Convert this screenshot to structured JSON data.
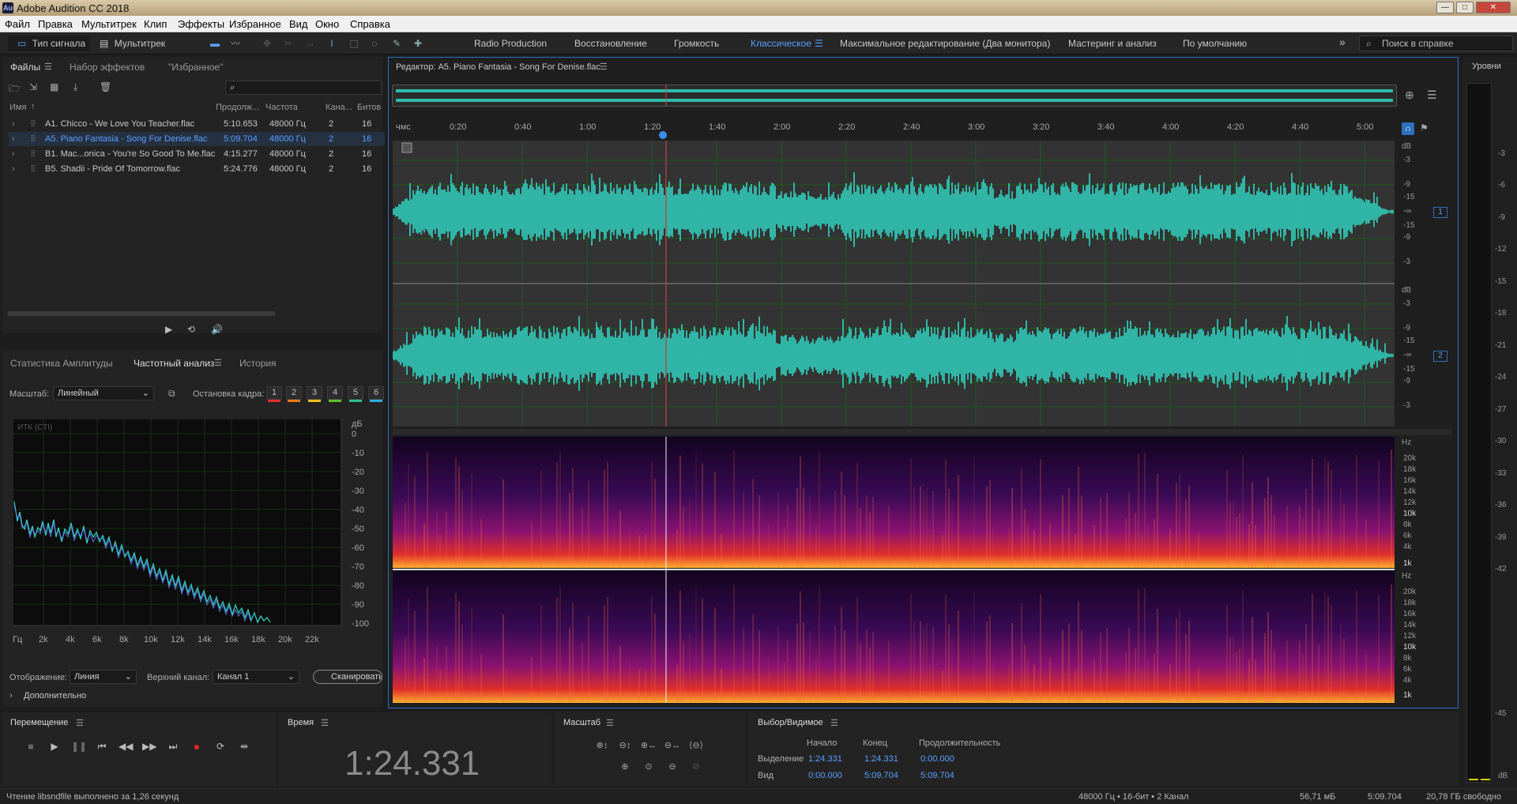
{
  "app": {
    "title": "Adobe Audition CC 2018",
    "logo": "Au",
    "window_controls": [
      "—",
      "□",
      "✕"
    ]
  },
  "menu": [
    "Файл",
    "Правка",
    "Мультитрек",
    "Клип",
    "Эффекты",
    "Избранное",
    "Вид",
    "Окно",
    "Справка"
  ],
  "toolbar": {
    "waveform_mode": "Тип сигнала",
    "multitrack_mode": "Мультитрек",
    "workspaces": [
      "Radio Production",
      "Восстановление",
      "Громкость",
      "Классическое",
      "Максимальное редактирование (Два монитора)",
      "Мастеринг и анализ",
      "По умолчанию"
    ],
    "active_workspace": "Классическое",
    "overflow": "»",
    "help_search_placeholder": "Поиск в справке"
  },
  "files_panel": {
    "tabs": [
      "Файлы",
      "Набор эффектов",
      "\"Избранное\""
    ],
    "filter_placeholder": "",
    "columns": [
      "Имя",
      "Продолж...",
      "Частота",
      "Кана...",
      "Битов"
    ],
    "files": [
      {
        "name": "A1. Chicco - We Love You Teacher.flac",
        "duration": "5:10.653",
        "rate": "48000 Гц",
        "channels": "2",
        "bits": "16",
        "selected": false
      },
      {
        "name": "A5. Piano Fantasia - Song For Denise.flac",
        "duration": "5:09.704",
        "rate": "48000 Гц",
        "channels": "2",
        "bits": "16",
        "selected": true
      },
      {
        "name": "B1. Mac...onica - You're So Good To Me.flac",
        "duration": "4:15.277",
        "rate": "48000 Гц",
        "channels": "2",
        "bits": "16",
        "selected": false
      },
      {
        "name": "B5. Shadii - Pride Of Tomorrow.flac",
        "duration": "5:24.776",
        "rate": "48000 Гц",
        "channels": "2",
        "bits": "16",
        "selected": false
      }
    ]
  },
  "analysis_panel": {
    "tabs": [
      "Статистика Амплитуды",
      "Частотный анализ",
      "История"
    ],
    "scale_label": "Масштаб:",
    "scale_value": "Линейный",
    "freeze_label": "Остановка кадра:",
    "freeze_slots": [
      {
        "n": "1",
        "color": "#e03030"
      },
      {
        "n": "2",
        "color": "#f07b1a"
      },
      {
        "n": "3",
        "color": "#f0c020"
      },
      {
        "n": "4",
        "color": "#60c030"
      },
      {
        "n": "5",
        "color": "#30c090"
      },
      {
        "n": "6",
        "color": "#30b0e0"
      }
    ],
    "chart_label": "ИТК (СТI)",
    "db_unit": "дБ",
    "db_ticks": [
      "0",
      "-10",
      "-20",
      "-30",
      "-40",
      "-50",
      "-60",
      "-70",
      "-80",
      "-90",
      "-100"
    ],
    "freq_ticks": [
      "Гц",
      "2k",
      "4k",
      "6k",
      "8k",
      "10k",
      "12k",
      "14k",
      "16k",
      "18k",
      "20k",
      "22k"
    ],
    "display_label": "Отображение:",
    "display_value": "Линия",
    "channel_label": "Верхний канал:",
    "channel_value": "Канал 1",
    "scan_button": "Сканировать",
    "advanced": "Дополнительно"
  },
  "editor": {
    "title": "Редактор: A5. Piano Fantasia - Song For Denise.flac",
    "ruler_unit": "чмс",
    "ruler_ticks": [
      "0:20",
      "0:40",
      "1:00",
      "1:20",
      "1:40",
      "2:00",
      "2:20",
      "2:40",
      "3:00",
      "3:20",
      "3:40",
      "4:00",
      "4:20",
      "4:40",
      "5:00"
    ],
    "db_ticks": [
      "dB",
      "-3",
      "-9",
      "-15",
      "-∞",
      "-15",
      "-9",
      "-3"
    ],
    "channels": [
      "1",
      "2"
    ],
    "hz_unit": "Hz",
    "hz_ticks": [
      "20k",
      "18k",
      "16k",
      "14k",
      "12k",
      "10k",
      "8k",
      "6k",
      "4k",
      "1k"
    ],
    "waveform_color": "#2fd6c3",
    "playhead_color": "#e04040"
  },
  "levels": {
    "title": "Уровни",
    "ticks": [
      "-3",
      "-6",
      "-9",
      "-12",
      "-15",
      "-18",
      "-21",
      "-24",
      "-27",
      "-30",
      "-33",
      "-36",
      "-39",
      "-42",
      "-45",
      "dB"
    ]
  },
  "transport": {
    "title": "Перемещение",
    "buttons": [
      "stop-icon",
      "play-icon",
      "pause-icon",
      "to-start-icon",
      "rewind-icon",
      "fast-forward-icon",
      "to-end-icon",
      "record-icon",
      "loop-icon",
      "skip-icon"
    ]
  },
  "time_panel": {
    "title": "Время",
    "value": "1:24.331"
  },
  "zoom_panel": {
    "title": "Масштаб"
  },
  "selection_panel": {
    "title": "Выбор/Видимое",
    "col_start": "Начало",
    "col_end": "Конец",
    "col_duration": "Продолжительность",
    "row_selection": "Выделение",
    "row_view": "Вид",
    "sel_start": "1:24.331",
    "sel_end": "1:24.331",
    "sel_duration": "0:00.000",
    "view_start": "0:00.000",
    "view_end": "5:09.704",
    "view_duration": "5:09.704"
  },
  "status": {
    "left": "Чтение libsndfile выполнено за 1,26 секунд",
    "format": "48000 Гц • 16-бит • 2 Канал",
    "size": "56,71 мБ",
    "duration": "5:09.704",
    "free": "20,78 ГБ свободно"
  }
}
